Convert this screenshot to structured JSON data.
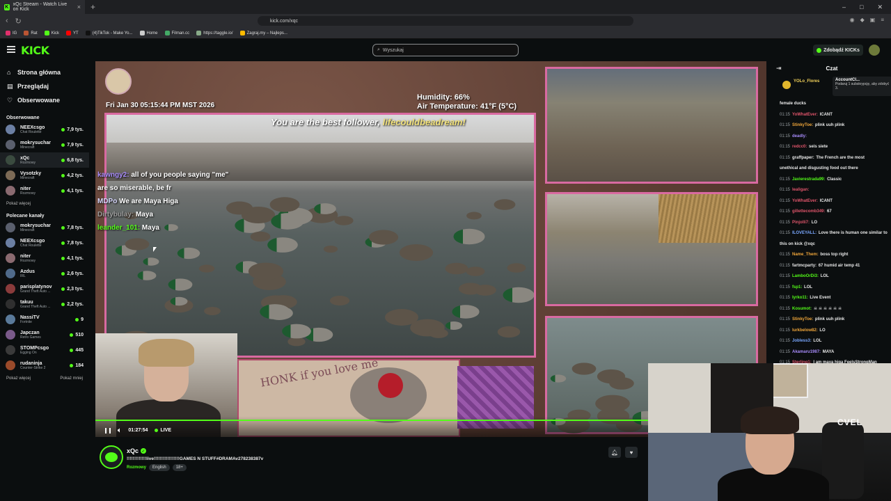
{
  "browser": {
    "tab_title": "xQc Stream - Watch Live on Kick",
    "url": "kick.com/xqc",
    "bookmarks": [
      "IG",
      "Rat",
      "Kick",
      "YT",
      "(4)TikTok - Make Yo...",
      "Home",
      "Filman.cc",
      "https://taggle.io/",
      "Zagraj.my – Najleps..."
    ]
  },
  "header": {
    "logo": "KICK",
    "search_placeholder": "Wyszukaj",
    "get_kicks": "Zdobądź KICKs"
  },
  "sidebar": {
    "nav": [
      {
        "label": "Strona główna",
        "icon": "home-icon"
      },
      {
        "label": "Przeglądaj",
        "icon": "browse-icon"
      },
      {
        "label": "Obserwowane",
        "icon": "heart-icon"
      }
    ],
    "followed_title": "Obserwowane",
    "followed": [
      {
        "name": "NEEXcsgo",
        "category": "Chat Roulette",
        "viewers": "7,9 tys.",
        "color": "#6b7fa3"
      },
      {
        "name": "mokrysuchar",
        "category": "Minecraft",
        "viewers": "7,9 tys.",
        "color": "#5a5f6d"
      },
      {
        "name": "xQc",
        "category": "Rozmowy",
        "viewers": "6,8 tys.",
        "color": "#3a4b3f"
      },
      {
        "name": "Vysotzky",
        "category": "Minecraft",
        "viewers": "4,2 tys.",
        "color": "#7c6a55"
      },
      {
        "name": "niter",
        "category": "Rozmowy",
        "viewers": "4,1 tys.",
        "color": "#8a6a70"
      }
    ],
    "show_more_1": "Pokaż więcej",
    "recommended_title": "Polecane kanały",
    "recommended": [
      {
        "name": "mokrysuchar",
        "category": "Minecraft",
        "viewers": "7,8 tys.",
        "color": "#5a5f6d"
      },
      {
        "name": "NEEXcsgo",
        "category": "Chat Roulette",
        "viewers": "7,8 tys.",
        "color": "#6b7fa3"
      },
      {
        "name": "niter",
        "category": "Rozmowy",
        "viewers": "4,1 tys.",
        "color": "#8a6a70"
      },
      {
        "name": "Azdus",
        "category": "IRL",
        "viewers": "2,6 tys.",
        "color": "#4f6a8a"
      },
      {
        "name": "parisplatynov",
        "category": "Grand Theft Auto ...",
        "viewers": "2,3 tys.",
        "color": "#8a3b3b"
      },
      {
        "name": "takuu",
        "category": "Grand Theft Auto ...",
        "viewers": "2,2 tys.",
        "color": "#2f2f2f"
      },
      {
        "name": "NassiTV",
        "category": "Fortnite",
        "viewers": "9",
        "color": "#5a7a9a"
      },
      {
        "name": "Japczan",
        "category": "Retro Games",
        "viewers": "510",
        "color": "#7a5a8a"
      },
      {
        "name": "STOMPcsgo",
        "category": "Egging On",
        "viewers": "445",
        "color": "#3a3a3a"
      },
      {
        "name": "rudaninja",
        "category": "Counter-Strike 2",
        "viewers": "184",
        "color": "#9a4a2a"
      }
    ],
    "show_more_2": "Pokaż więcej",
    "show_less": "Pokaż mniej"
  },
  "video": {
    "date": "Fri Jan 30 05:15:44 PM MST 2026",
    "humidity": "Humidity: 66%",
    "air_temp": "Air Temperature: 41°F (5°C)",
    "follower_prefix": "You are the best follower,",
    "follower_name": "lifecouldbeadream!",
    "overlay_chat": [
      {
        "user": "kawngy2:",
        "text": " all of you people saying \"me\""
      },
      {
        "user": "",
        "text": "are so miserable, be fr"
      },
      {
        "user": "MDPo",
        "text": " We are Maya Higa"
      },
      {
        "user": "Dirtybulay:",
        "text": " Maya"
      },
      {
        "user": "leander_101:",
        "text": " Maya"
      }
    ],
    "card_text": "HONK if you love me",
    "time": "01:27:54",
    "live": "LIVE"
  },
  "streamer": {
    "name": "xQc",
    "title": "!!!!!!!!!!!!!live!!!!!!!!!!!!!!!!!GAMES N STUFF#DRAMAv278238387v",
    "category": "Rozmowy",
    "tags": [
      "English",
      "18+"
    ]
  },
  "chat": {
    "title": "Czat",
    "pinned_user": "YOLo_Flores",
    "pinned_account": "AccountCl...",
    "pinned_text": "Podaruj 1 subskrypcję, aby zdobyć 3.",
    "pre_message": "female ducks",
    "messages": [
      {
        "time": "01:15",
        "user": "YoWhatEver:",
        "text": "ICANT",
        "color": "#e0556b"
      },
      {
        "time": "01:15",
        "user": "StinkyToe:",
        "text": "plink uuh plink",
        "color": "#f0a63a"
      },
      {
        "time": "01:15",
        "user": "deadly:",
        "text": "",
        "color": "#a78bfa"
      },
      {
        "time": "01:15",
        "user": "redcc0:",
        "text": "seis siete",
        "color": "#e0556b"
      },
      {
        "time": "01:15",
        "user": "graffpaper:",
        "text": "The French are the most",
        "color": "#e8e8e8"
      },
      {
        "time": "",
        "user": "",
        "text": "unethical and disgusting food out there",
        "color": "#e8e8e8"
      },
      {
        "time": "01:15",
        "user": "Javierestrada99:",
        "text": "Classic",
        "color": "#53fc18"
      },
      {
        "time": "01:15",
        "user": "lealigan:",
        "text": "",
        "color": "#e0556b"
      },
      {
        "time": "01:15",
        "user": "YoWhatEver:",
        "text": "ICANT",
        "color": "#e0556b"
      },
      {
        "time": "01:15",
        "user": "gillettecomb349:",
        "text": "67",
        "color": "#e0556b"
      },
      {
        "time": "01:15",
        "user": "Pinjolli7:",
        "text": "LO",
        "color": "#e0556b"
      },
      {
        "time": "01:15",
        "user": "ILOVEYALL:",
        "text": "Love there is human one similar to",
        "color": "#7aa8ff"
      },
      {
        "time": "",
        "user": "",
        "text": "this on kick @xqc",
        "color": "#e8e8e8"
      },
      {
        "time": "01:15",
        "user": "Name_Them:",
        "text": "boss top right",
        "color": "#f0a63a"
      },
      {
        "time": "01:15",
        "user": "fartmcparty:",
        "text": "67 humid air temp 41",
        "color": "#e8e8e8"
      },
      {
        "time": "01:15",
        "user": "LamboOrDi3:",
        "text": "LOL",
        "color": "#53fc18"
      },
      {
        "time": "01:15",
        "user": "fsp1:",
        "text": "LOL",
        "color": "#53fc18"
      },
      {
        "time": "01:15",
        "user": "Iyrko11:",
        "text": "Live Event",
        "color": "#53fc18"
      },
      {
        "time": "01:15",
        "user": "Kosumot:",
        "text": "☠ ☠ ☠ ☠ ☠ ☠",
        "color": "#53fc18"
      },
      {
        "time": "01:15",
        "user": "StinkyToe:",
        "text": "plink uuh plink",
        "color": "#f0a63a"
      },
      {
        "time": "01:15",
        "user": "lurkbelow82:",
        "text": "LO",
        "color": "#f0a63a"
      },
      {
        "time": "01:15",
        "user": "Jobless3:",
        "text": "LOL",
        "color": "#7aa8ff"
      },
      {
        "time": "01:15",
        "user": "Akamaru1987:",
        "text": "MAYA",
        "color": "#a78bfa"
      },
      {
        "time": "01:15",
        "user": "Sterling1:",
        "text": "I am maya higa FeelsStrongMan",
        "color": "#e0556b"
      }
    ]
  },
  "facecam": {
    "sign": "CVEL"
  }
}
